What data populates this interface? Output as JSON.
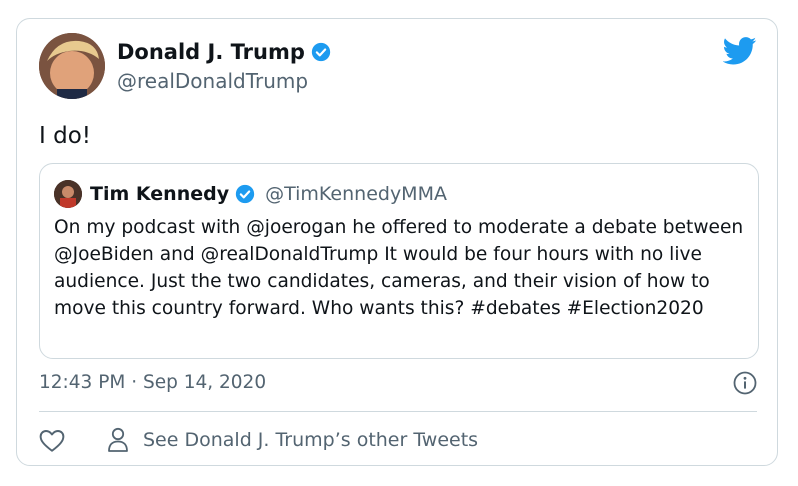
{
  "tweet": {
    "author_name": "Donald J. Trump",
    "author_handle": "@realDonaldTrump",
    "text": "I do!",
    "timestamp": "12:43 PM · Sep 14, 2020",
    "other_tweets_label": "See Donald J. Trump’s other Tweets"
  },
  "quoted": {
    "author_name": "Tim Kennedy",
    "author_handle": "@TimKennedyMMA",
    "text": "On my podcast with @joerogan he offered to moderate a debate between @JoeBiden and @realDonaldTrump It would be four hours with no live audience. Just the two candidates, cameras, and their vision of how to move this country forward. Who wants this? #debates #Election2020"
  },
  "icons": {
    "brand": "twitter-bird-icon",
    "verified": "verified-badge-icon",
    "info": "info-icon",
    "like": "heart-icon",
    "profile": "person-icon"
  },
  "colors": {
    "brand": "#1d9bf0",
    "text": "#0f1419",
    "secondary": "#536471",
    "border": "#cfd9de"
  }
}
